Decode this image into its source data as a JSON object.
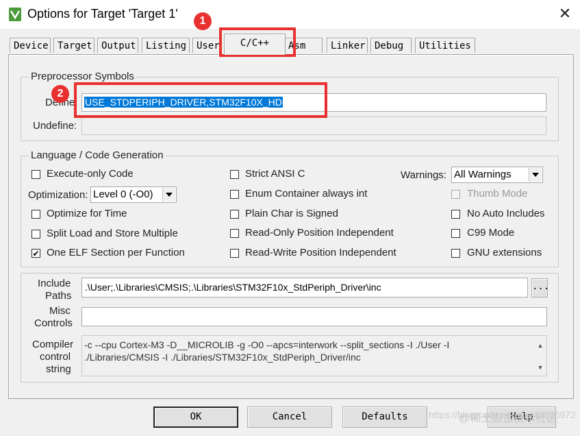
{
  "window": {
    "title": "Options for Target 'Target 1'",
    "icon": "keil-app-icon",
    "close_glyph": "✕"
  },
  "tabs": [
    {
      "label": "Device"
    },
    {
      "label": "Target"
    },
    {
      "label": "Output"
    },
    {
      "label": "Listing"
    },
    {
      "label": "User"
    },
    {
      "label": "C/C++",
      "active": true
    },
    {
      "label": "Asm"
    },
    {
      "label": "Linker"
    },
    {
      "label": "Debug"
    },
    {
      "label": "Utilities"
    }
  ],
  "preprocessor": {
    "group_label": "Preprocessor Symbols",
    "define_label": "Define:",
    "define_value": "USE_STDPERIPH_DRIVER,STM32F10X_HD",
    "undefine_label": "Undefine:",
    "undefine_value": ""
  },
  "codegen": {
    "group_label": "Language / Code Generation",
    "execute_only": {
      "label": "Execute-only Code",
      "checked": false
    },
    "optimization_label": "Optimization:",
    "optimization_value": "Level 0 (-O0)",
    "optimize_time": {
      "label": "Optimize for Time",
      "checked": false
    },
    "split_load": {
      "label": "Split Load and Store Multiple",
      "checked": false
    },
    "one_elf": {
      "label": "One ELF Section per Function",
      "checked": true
    },
    "strict_ansi": {
      "label": "Strict ANSI C",
      "checked": false
    },
    "enum_container": {
      "label": "Enum Container always int",
      "checked": false
    },
    "plain_char": {
      "label": "Plain Char is Signed",
      "checked": false
    },
    "ro_position": {
      "label": "Read-Only Position Independent",
      "checked": false
    },
    "rw_position": {
      "label": "Read-Write Position Independent",
      "checked": false
    },
    "warnings_label": "Warnings:",
    "warnings_value": "All Warnings",
    "thumb_mode": {
      "label": "Thumb Mode",
      "checked": false,
      "disabled": true
    },
    "no_auto_includes": {
      "label": "No Auto Includes",
      "checked": false
    },
    "c99_mode": {
      "label": "C99 Mode",
      "checked": false
    },
    "gnu_extensions": {
      "label": "GNU extensions",
      "checked": false
    }
  },
  "paths": {
    "include_label_1": "Include",
    "include_label_2": "Paths",
    "include_value": ".\\User;.\\Libraries\\CMSIS;.\\Libraries\\STM32F10x_StdPeriph_Driver\\inc",
    "browse_label": "...",
    "misc_label_1": "Misc",
    "misc_label_2": "Controls",
    "misc_value": "",
    "compiler_label_1": "Compiler",
    "compiler_label_2": "control",
    "compiler_label_3": "string",
    "compiler_line_1": "-c --cpu Cortex-M3 -D__MICROLIB -g -O0 --apcs=interwork --split_sections -I ./User -I",
    "compiler_line_2": "./Libraries/CMSIS -I ./Libraries/STM32F10x_StdPeriph_Driver/inc"
  },
  "buttons": {
    "ok": "OK",
    "cancel": "Cancel",
    "defaults": "Defaults",
    "help": "Help"
  },
  "annotations": {
    "badge_1": "1",
    "badge_2": "2",
    "color": "#e8312f"
  },
  "watermark": {
    "text_1": "https://blog.csdn.net/qq_43836972",
    "text_2": "@稀土掘金技术社区"
  }
}
